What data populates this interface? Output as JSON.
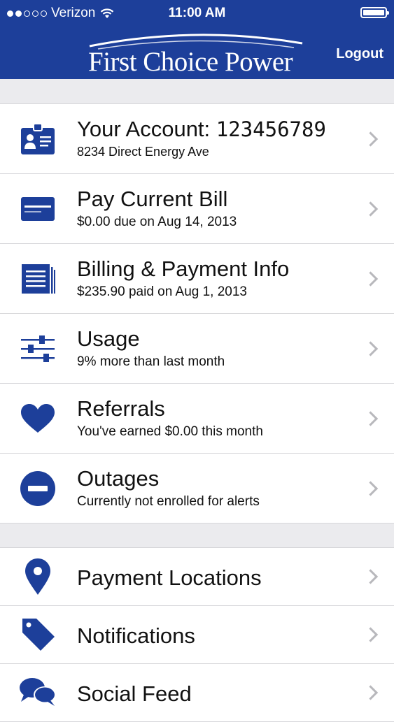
{
  "status_bar": {
    "carrier": "Verizon",
    "time": "11:00 AM"
  },
  "header": {
    "brand": "First Choice Power",
    "logout_label": "Logout",
    "background_color": "#1d3f9a"
  },
  "menu": [
    {
      "icon": "account-card-icon",
      "title_prefix": "Your Account: ",
      "title_value": "123456789",
      "subtitle": "8234 Direct Energy Ave"
    },
    {
      "icon": "credit-card-icon",
      "title": "Pay Current Bill",
      "subtitle": "$0.00 due on Aug 14, 2013"
    },
    {
      "icon": "document-icon",
      "title": "Billing & Payment Info",
      "subtitle": "$235.90 paid on Aug 1, 2013"
    },
    {
      "icon": "sliders-icon",
      "title": "Usage",
      "subtitle": "9% more than last month"
    },
    {
      "icon": "heart-icon",
      "title": "Referrals",
      "subtitle": "You've earned $0.00 this month"
    },
    {
      "icon": "minus-circle-icon",
      "title": "Outages",
      "subtitle": "Currently not enrolled for alerts"
    }
  ],
  "secondary_menu": [
    {
      "icon": "map-pin-icon",
      "title": "Payment Locations"
    },
    {
      "icon": "tag-icon",
      "title": "Notifications"
    },
    {
      "icon": "chat-bubbles-icon",
      "title": "Social Feed"
    }
  ],
  "icon_color": "#1d3f9a"
}
